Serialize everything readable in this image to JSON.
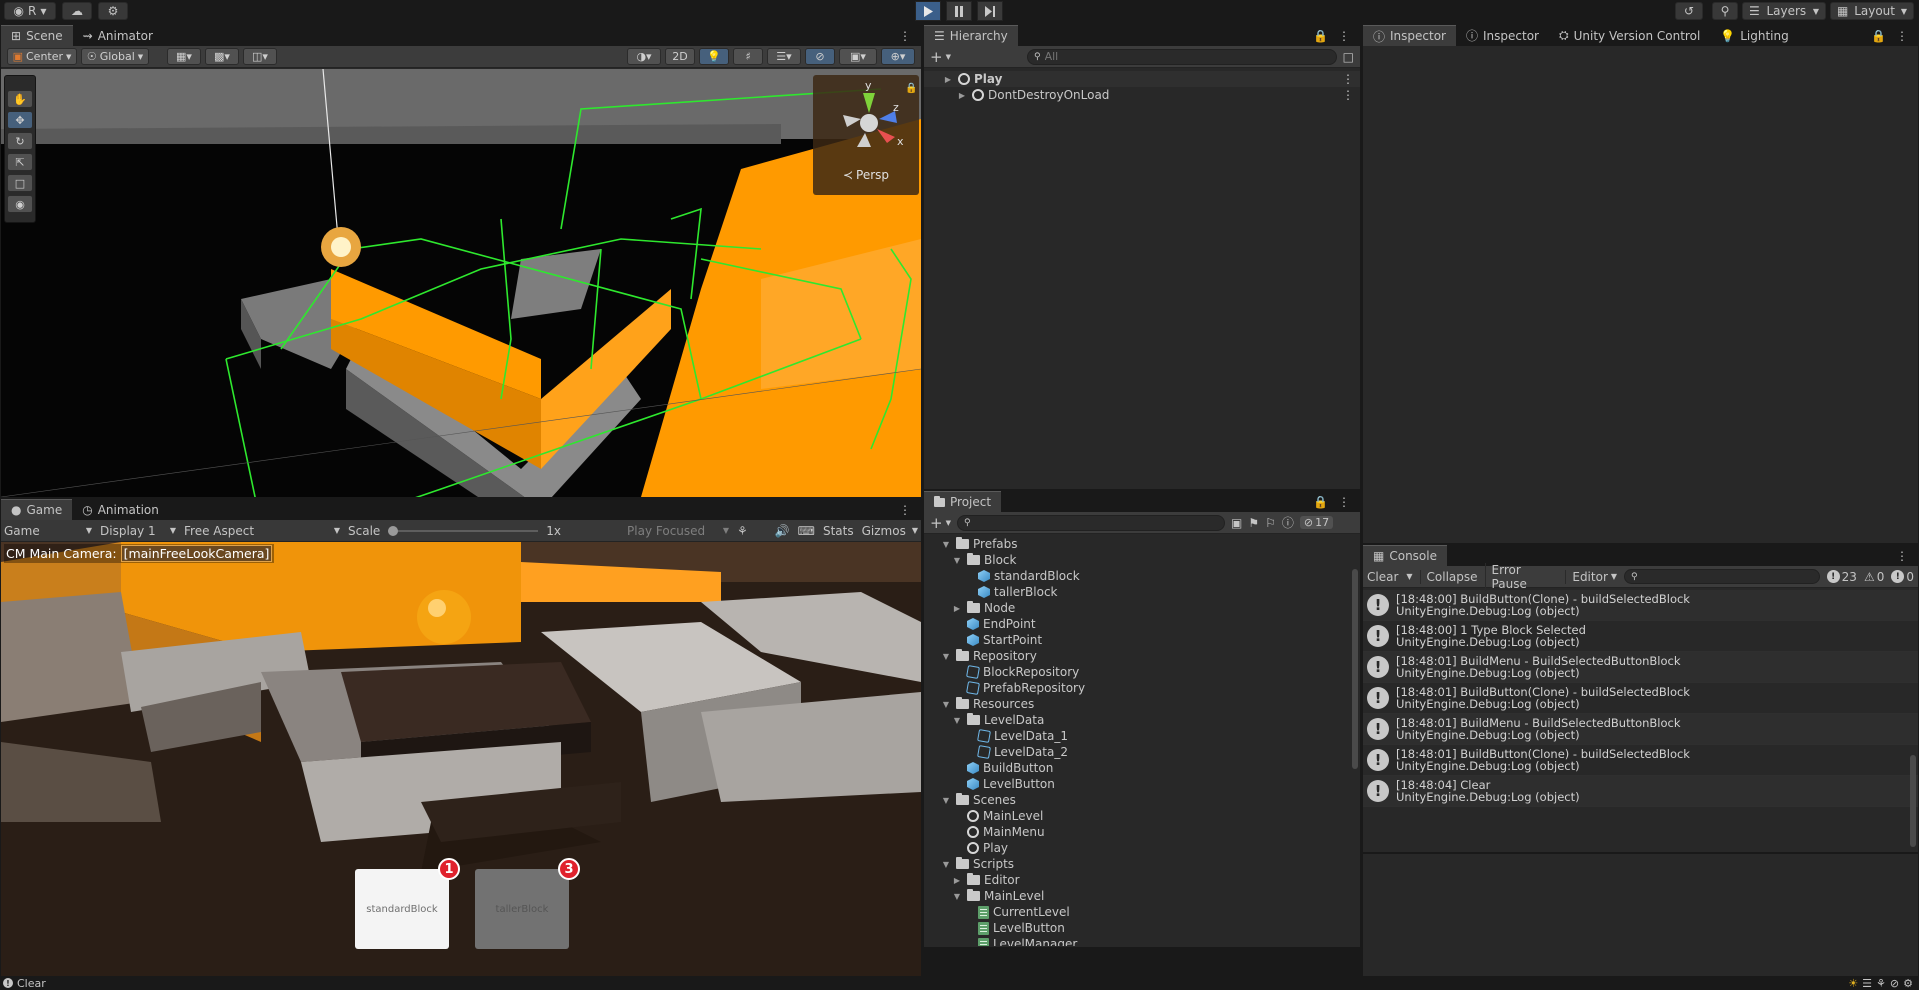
{
  "topbar": {
    "account_label": "R",
    "layers_label": "Layers",
    "layout_label": "Layout"
  },
  "scene": {
    "tabs": [
      "Scene",
      "Animator"
    ],
    "pivot_label": "Center",
    "space_label": "Global",
    "mode_2d": "2D",
    "gizmo_axes": {
      "y": "y",
      "z": "z",
      "x": "x"
    },
    "persp_label": "Persp"
  },
  "game": {
    "tabs": [
      "Game",
      "Animation"
    ],
    "view_label": "Game",
    "display_label": "Display 1",
    "aspect_label": "Free Aspect",
    "scale_label": "Scale",
    "scale_value": "1x",
    "play_focus_label": "Play Focused",
    "stats_label": "Stats",
    "gizmos_label": "Gizmos",
    "camera_overlay_prefix": "CM Main Camera:",
    "camera_overlay_name": "[mainFreeLookCamera]",
    "block_buttons": [
      {
        "label": "standardBlock",
        "count": "1"
      },
      {
        "label": "tallerBlock",
        "count": "3"
      }
    ]
  },
  "hierarchy": {
    "tab": "Hierarchy",
    "search_placeholder": "All",
    "items": [
      {
        "label": "Play"
      },
      {
        "label": "DontDestroyOnLoad"
      }
    ]
  },
  "inspector": {
    "tabs": [
      "Inspector",
      "Inspector",
      "Unity Version Control",
      "Lighting"
    ]
  },
  "project": {
    "tab": "Project",
    "hidden_count": "17",
    "tree": [
      {
        "label": "Prefabs",
        "icon": "folder",
        "fold": "open",
        "depth": 0
      },
      {
        "label": "Block",
        "icon": "folder",
        "fold": "open",
        "depth": 1
      },
      {
        "label": "standardBlock",
        "icon": "prefab",
        "fold": "",
        "depth": 2
      },
      {
        "label": "tallerBlock",
        "icon": "prefab",
        "fold": "",
        "depth": 2
      },
      {
        "label": "Node",
        "icon": "folder",
        "fold": "closed",
        "depth": 1
      },
      {
        "label": "EndPoint",
        "icon": "prefab",
        "fold": "",
        "depth": 1
      },
      {
        "label": "StartPoint",
        "icon": "prefab",
        "fold": "",
        "depth": 1
      },
      {
        "label": "Repository",
        "icon": "folder",
        "fold": "open",
        "depth": 0
      },
      {
        "label": "BlockRepository",
        "icon": "scriptable",
        "fold": "",
        "depth": 1
      },
      {
        "label": "PrefabRepository",
        "icon": "scriptable",
        "fold": "",
        "depth": 1
      },
      {
        "label": "Resources",
        "icon": "folder",
        "fold": "open",
        "depth": 0
      },
      {
        "label": "LevelData",
        "icon": "folder",
        "fold": "open",
        "depth": 1
      },
      {
        "label": "LevelData_1",
        "icon": "scriptable",
        "fold": "",
        "depth": 2
      },
      {
        "label": "LevelData_2",
        "icon": "scriptable",
        "fold": "",
        "depth": 2
      },
      {
        "label": "BuildButton",
        "icon": "prefab",
        "fold": "",
        "depth": 1
      },
      {
        "label": "LevelButton",
        "icon": "prefab",
        "fold": "",
        "depth": 1
      },
      {
        "label": "Scenes",
        "icon": "folder",
        "fold": "open",
        "depth": 0
      },
      {
        "label": "MainLevel",
        "icon": "scene",
        "fold": "",
        "depth": 1
      },
      {
        "label": "MainMenu",
        "icon": "scene",
        "fold": "",
        "depth": 1
      },
      {
        "label": "Play",
        "icon": "scene",
        "fold": "",
        "depth": 1
      },
      {
        "label": "Scripts",
        "icon": "folder",
        "fold": "open",
        "depth": 0
      },
      {
        "label": "Editor",
        "icon": "folder",
        "fold": "closed",
        "depth": 1
      },
      {
        "label": "MainLevel",
        "icon": "folder",
        "fold": "open",
        "depth": 1
      },
      {
        "label": "CurrentLevel",
        "icon": "script",
        "fold": "",
        "depth": 2
      },
      {
        "label": "LevelButton",
        "icon": "script",
        "fold": "",
        "depth": 2
      },
      {
        "label": "LevelManager",
        "icon": "script",
        "fold": "",
        "depth": 2
      }
    ]
  },
  "console": {
    "tab": "Console",
    "clear_label": "Clear",
    "collapse_label": "Collapse",
    "error_pause_label": "Error Pause",
    "editor_label": "Editor",
    "log_count": "23",
    "warn_count": "0",
    "error_count": "0",
    "entries": [
      {
        "line1": "[18:48:00] BuildButton(Clone) - buildSelectedBlock",
        "line2": "UnityEngine.Debug:Log (object)"
      },
      {
        "line1": "[18:48:00] 1 Type Block Selected",
        "line2": "UnityEngine.Debug:Log (object)"
      },
      {
        "line1": "[18:48:01] BuildMenu - BuildSelectedButtonBlock",
        "line2": "UnityEngine.Debug:Log (object)"
      },
      {
        "line1": "[18:48:01] BuildButton(Clone) - buildSelectedBlock",
        "line2": "UnityEngine.Debug:Log (object)"
      },
      {
        "line1": "[18:48:01] BuildMenu - BuildSelectedButtonBlock",
        "line2": "UnityEngine.Debug:Log (object)"
      },
      {
        "line1": "[18:48:01] BuildButton(Clone) - buildSelectedBlock",
        "line2": "UnityEngine.Debug:Log (object)"
      },
      {
        "line1": "[18:48:04] Clear",
        "line2": "UnityEngine.Debug:Log (object)"
      }
    ]
  },
  "statusbar": {
    "message": "Clear"
  },
  "colors": {
    "accent": "#3b5f8a",
    "orange": "#ff9a00",
    "green_gizmo": "#2ee82e"
  }
}
